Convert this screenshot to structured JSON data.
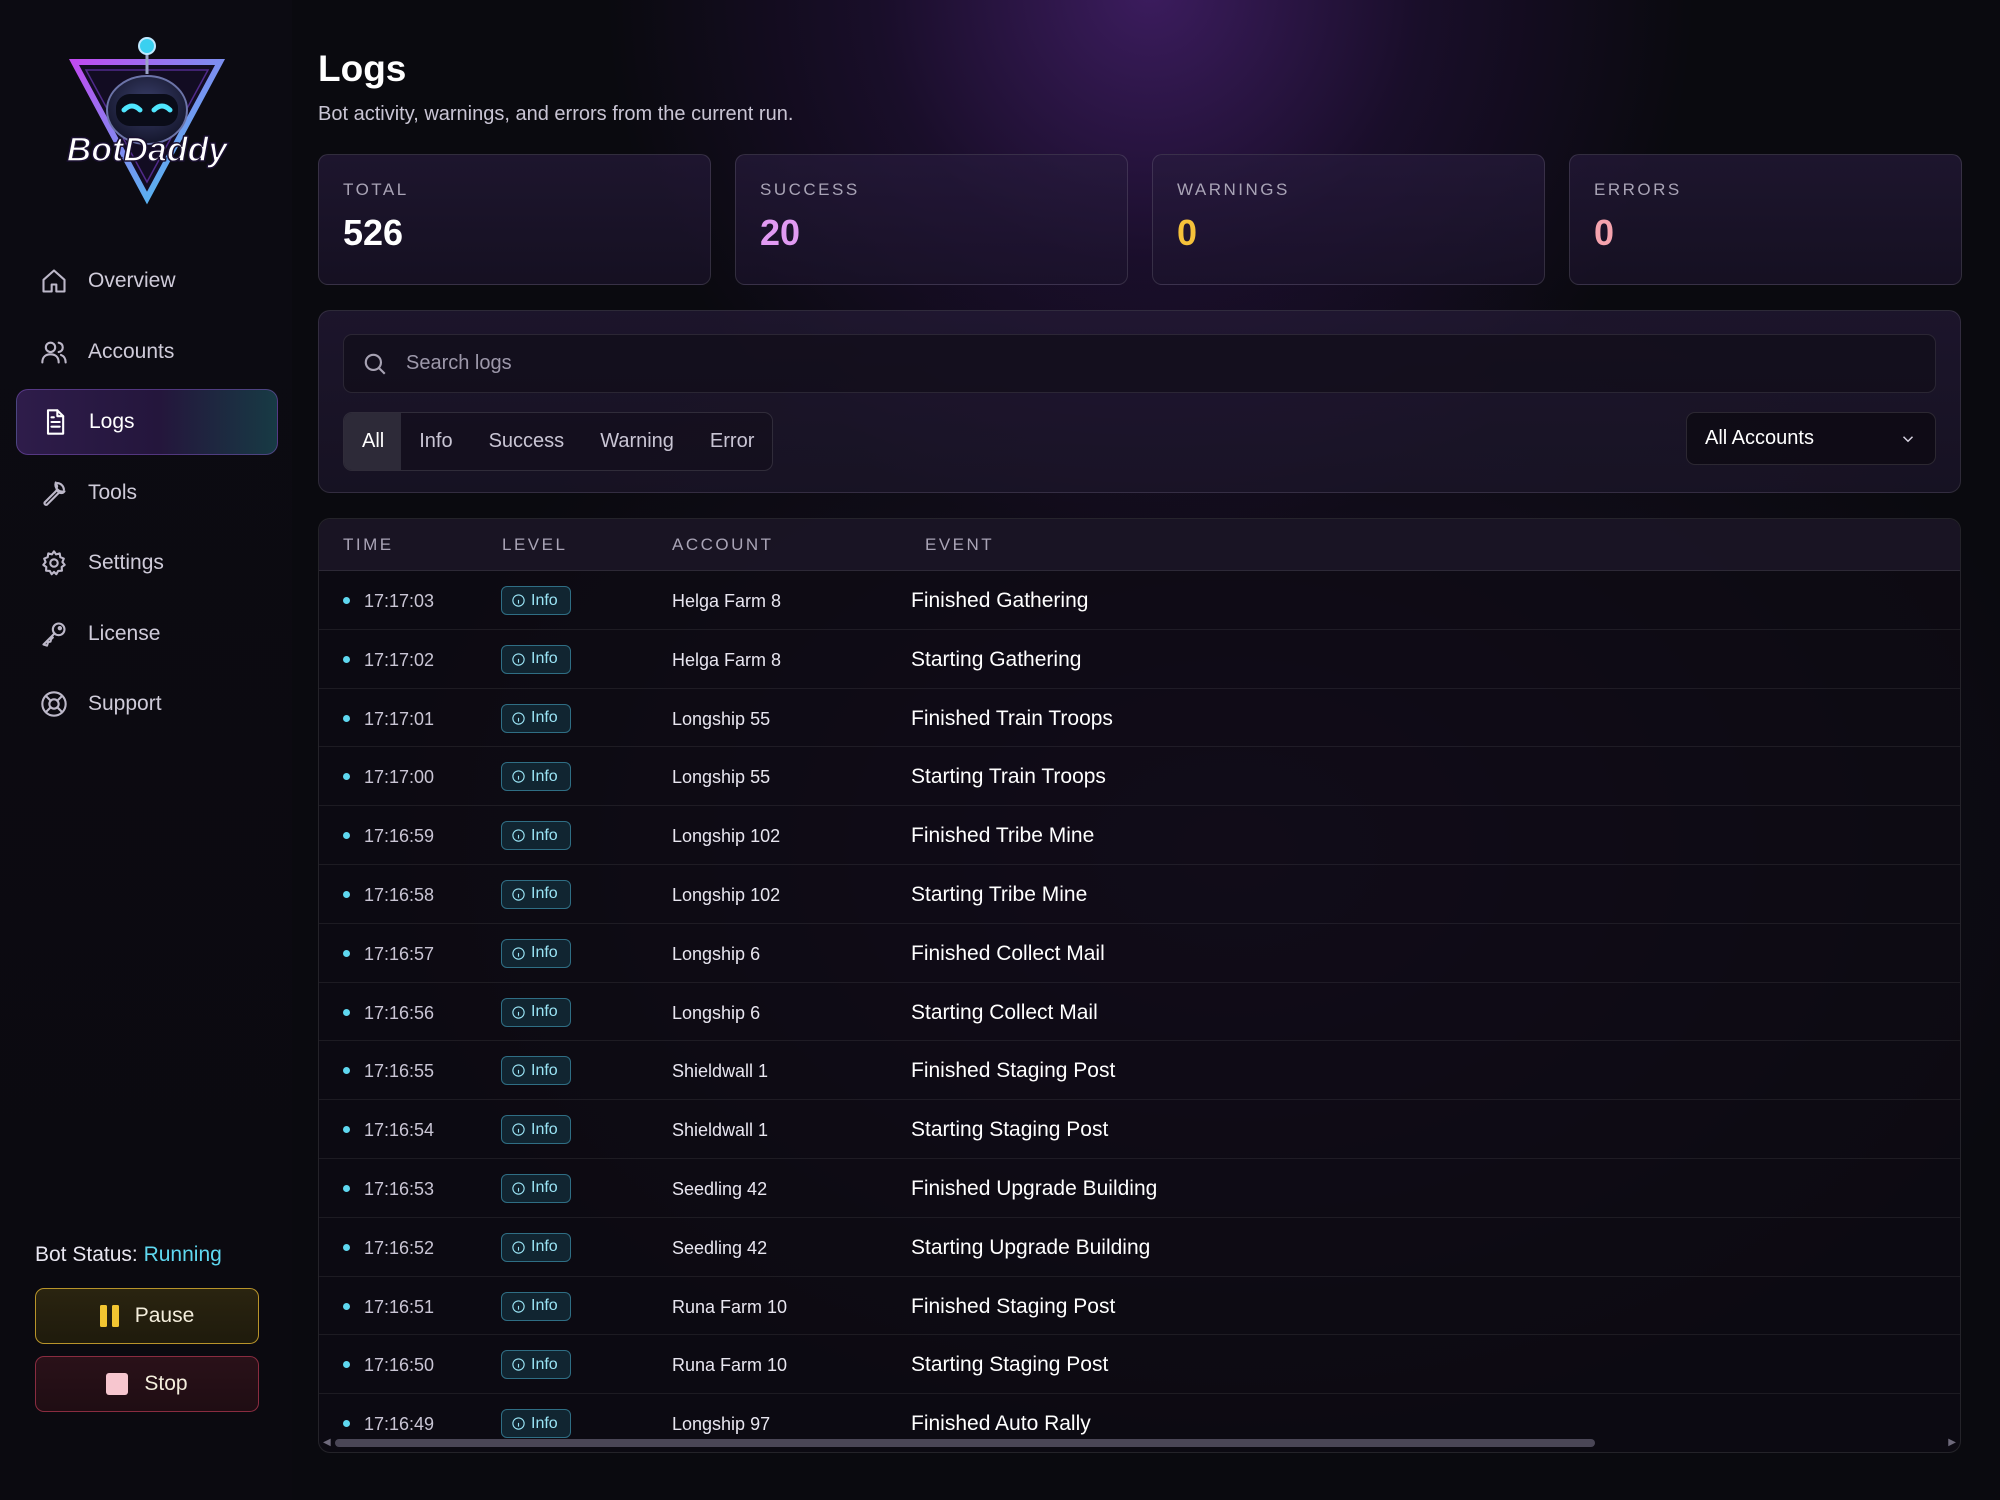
{
  "app": {
    "logo_text": "BotDaddy"
  },
  "sidebar": {
    "items": [
      {
        "label": "Overview",
        "icon": "home-icon"
      },
      {
        "label": "Accounts",
        "icon": "users-icon"
      },
      {
        "label": "Logs",
        "icon": "document-icon",
        "active": true
      },
      {
        "label": "Tools",
        "icon": "wrench-icon"
      },
      {
        "label": "Settings",
        "icon": "gear-icon"
      },
      {
        "label": "License",
        "icon": "key-icon"
      },
      {
        "label": "Support",
        "icon": "lifebuoy-icon"
      }
    ],
    "bot_status_label": "Bot Status:",
    "bot_status_value": "Running",
    "pause_label": "Pause",
    "stop_label": "Stop"
  },
  "header": {
    "title": "Logs",
    "subtitle": "Bot activity, warnings, and errors from the current run."
  },
  "stats": [
    {
      "label": "TOTAL",
      "value": "526",
      "color": "#ffffff"
    },
    {
      "label": "SUCCESS",
      "value": "20",
      "color": "#e19af2"
    },
    {
      "label": "WARNINGS",
      "value": "0",
      "color": "#f5c13a"
    },
    {
      "label": "ERRORS",
      "value": "0",
      "color": "#f5a3ae"
    }
  ],
  "filters": {
    "search_placeholder": "Search logs",
    "levels": [
      "All",
      "Info",
      "Success",
      "Warning",
      "Error"
    ],
    "selected_level": "All",
    "account_select": "All Accounts"
  },
  "table": {
    "columns": [
      "TIME",
      "LEVEL",
      "ACCOUNT",
      "EVENT"
    ],
    "rows": [
      {
        "time": "17:17:03",
        "level": "Info",
        "account": "Helga Farm 8",
        "event": "Finished Gathering"
      },
      {
        "time": "17:17:02",
        "level": "Info",
        "account": "Helga Farm 8",
        "event": "Starting Gathering"
      },
      {
        "time": "17:17:01",
        "level": "Info",
        "account": "Longship 55",
        "event": "Finished Train Troops"
      },
      {
        "time": "17:17:00",
        "level": "Info",
        "account": "Longship 55",
        "event": "Starting Train Troops"
      },
      {
        "time": "17:16:59",
        "level": "Info",
        "account": "Longship 102",
        "event": "Finished Tribe Mine"
      },
      {
        "time": "17:16:58",
        "level": "Info",
        "account": "Longship 102",
        "event": "Starting Tribe Mine"
      },
      {
        "time": "17:16:57",
        "level": "Info",
        "account": "Longship 6",
        "event": "Finished Collect Mail"
      },
      {
        "time": "17:16:56",
        "level": "Info",
        "account": "Longship 6",
        "event": "Starting Collect Mail"
      },
      {
        "time": "17:16:55",
        "level": "Info",
        "account": "Shieldwall 1",
        "event": "Finished Staging Post"
      },
      {
        "time": "17:16:54",
        "level": "Info",
        "account": "Shieldwall 1",
        "event": "Starting Staging Post"
      },
      {
        "time": "17:16:53",
        "level": "Info",
        "account": "Seedling 42",
        "event": "Finished Upgrade Building"
      },
      {
        "time": "17:16:52",
        "level": "Info",
        "account": "Seedling 42",
        "event": "Starting Upgrade Building"
      },
      {
        "time": "17:16:51",
        "level": "Info",
        "account": "Runa Farm 10",
        "event": "Finished Staging Post"
      },
      {
        "time": "17:16:50",
        "level": "Info",
        "account": "Runa Farm 10",
        "event": "Starting Staging Post"
      },
      {
        "time": "17:16:49",
        "level": "Info",
        "account": "Longship 97",
        "event": "Finished Auto Rally"
      }
    ]
  }
}
